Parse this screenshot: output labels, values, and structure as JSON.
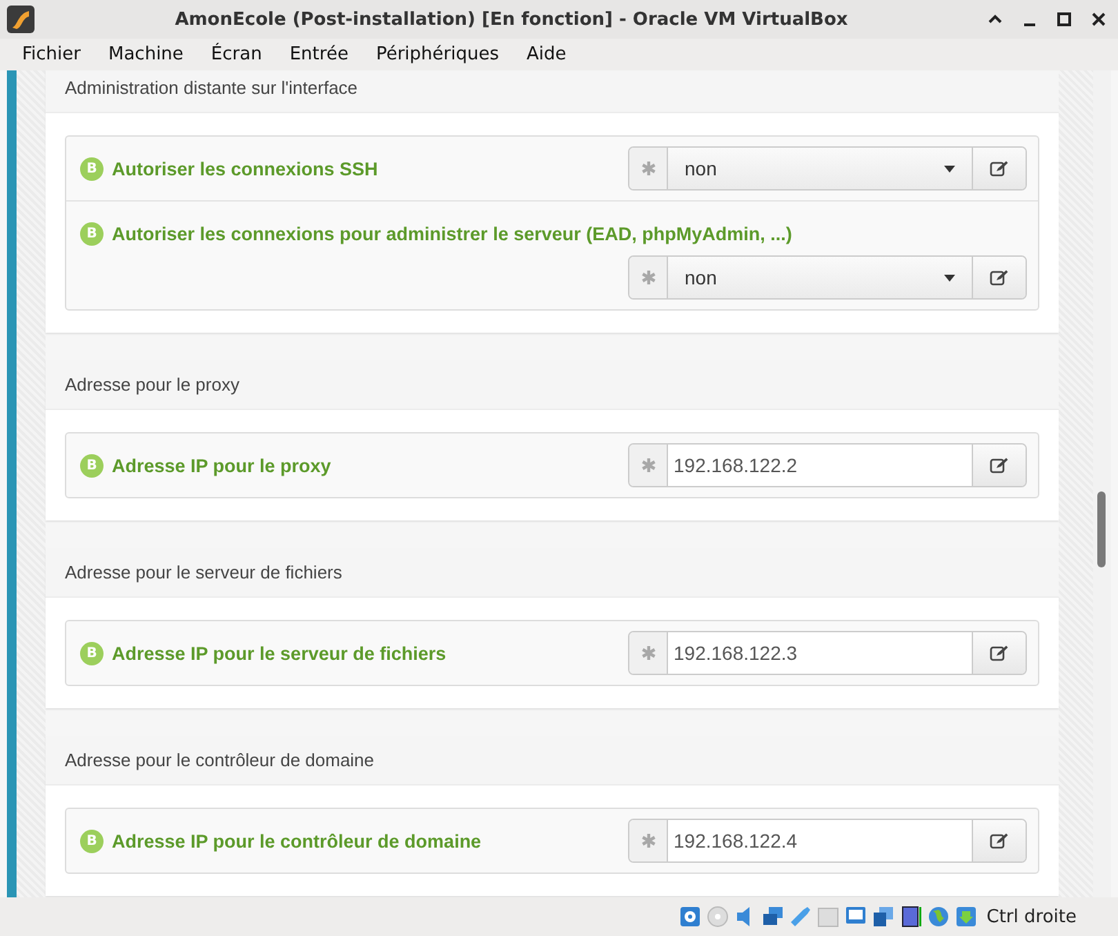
{
  "window": {
    "title": "AmonEcole (Post-installation) [En fonction] - Oracle VM VirtualBox"
  },
  "menu": [
    "Fichier",
    "Machine",
    "Écran",
    "Entrée",
    "Périphériques",
    "Aide"
  ],
  "sections": [
    {
      "heading": "Administration distante sur l'interface",
      "rows": [
        {
          "badge": "B",
          "label": "Autoriser les connexions SSH",
          "kind": "select",
          "value": "non"
        },
        {
          "badge": "B",
          "label": "Autoriser les connexions pour administrer le serveur (EAD, phpMyAdmin, ...)",
          "kind": "select",
          "value": "non"
        }
      ]
    },
    {
      "heading": "Adresse pour le proxy",
      "rows": [
        {
          "badge": "B",
          "label": "Adresse IP pour le proxy",
          "kind": "input",
          "value": "192.168.122.2"
        }
      ]
    },
    {
      "heading": "Adresse pour le serveur de fichiers",
      "rows": [
        {
          "badge": "B",
          "label": "Adresse IP pour le serveur de fichiers",
          "kind": "input",
          "value": "192.168.122.3"
        }
      ]
    },
    {
      "heading": "Adresse pour le contrôleur de domaine",
      "rows": [
        {
          "badge": "B",
          "label": "Adresse IP pour le contrôleur de domaine",
          "kind": "input",
          "value": "192.168.122.4"
        }
      ]
    }
  ],
  "status_bar": {
    "host_key": "Ctrl droite"
  }
}
